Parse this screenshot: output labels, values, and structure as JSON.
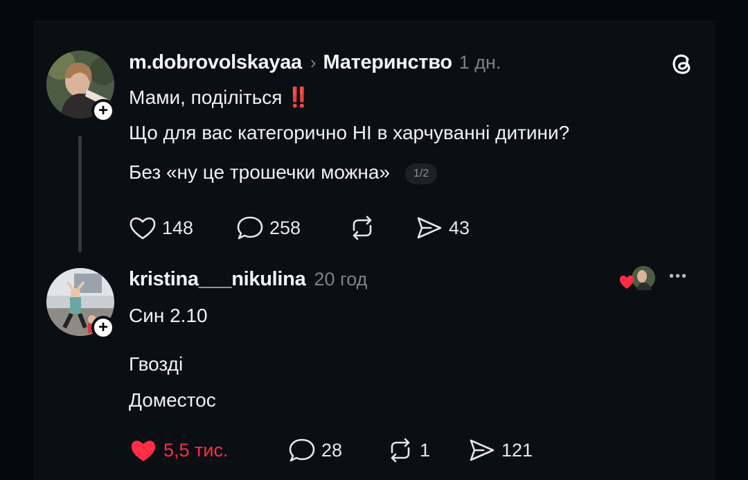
{
  "post": {
    "username": "m.dobrovolskayaa",
    "separator": "›",
    "community": "Материнство",
    "time": "1 дн.",
    "line1_text": "Мами, поділіться",
    "line1_emoji": "‼️",
    "line2": "Що для вас категорично НІ в харчуванні дитини?",
    "line3": "Без «ну це трошечки можна»",
    "page_indicator": "1/2",
    "likes": "148",
    "comments": "258",
    "shares": "43",
    "logo_icon": "threads-logo-icon"
  },
  "reply": {
    "username": "kristina___nikulina",
    "time": "20 год",
    "line1": "Син 2.10",
    "line2": "Гвозді",
    "line3": "Доместос",
    "likes": "5,5 тис.",
    "comments": "28",
    "reposts": "1",
    "shares": "121",
    "more_icon": "•••"
  },
  "colors": {
    "like_red": "#ff2d45",
    "muted": "#7b8288",
    "background": "#0a0f14"
  }
}
